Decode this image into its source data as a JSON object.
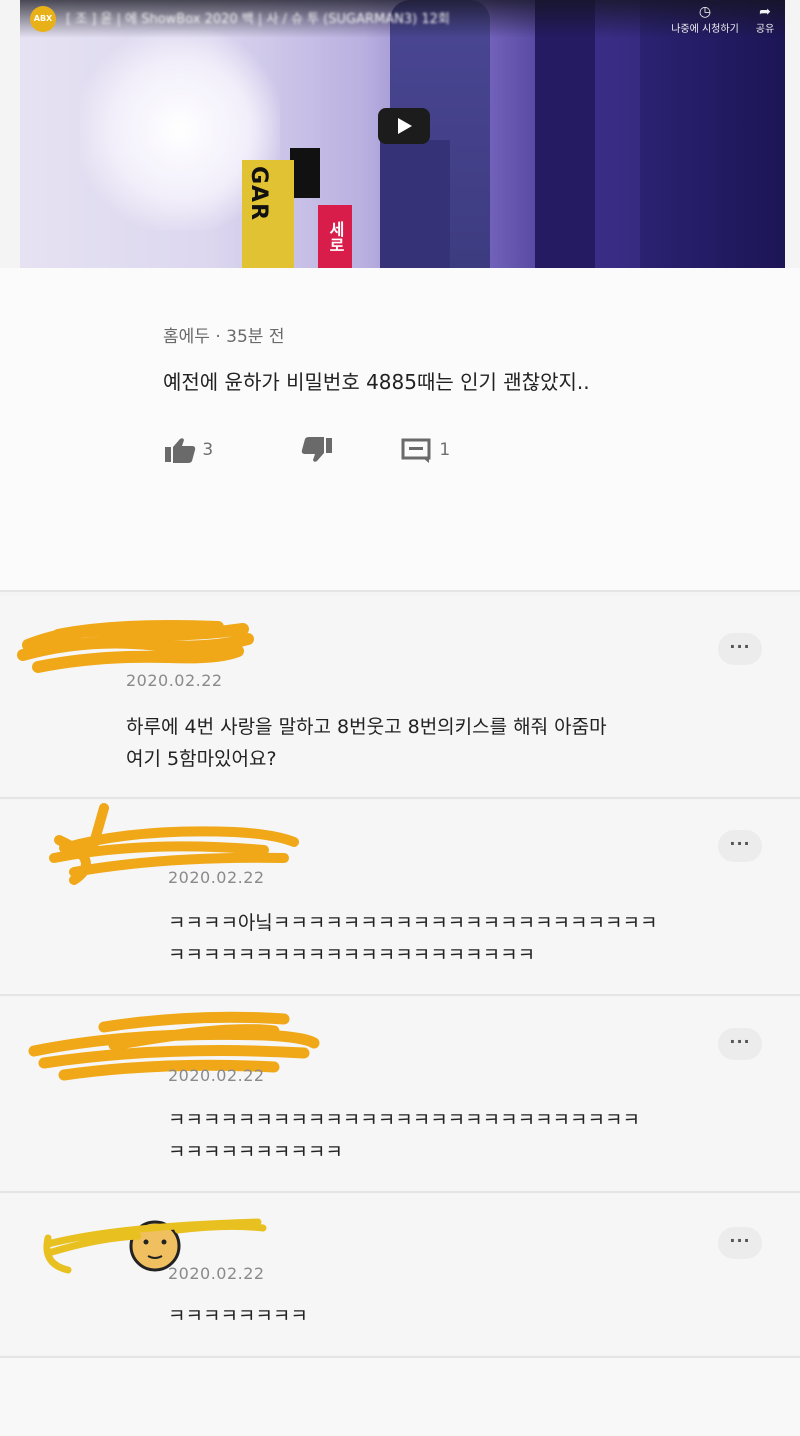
{
  "video": {
    "channel_badge": "ABX",
    "title": "[ 조 ] 윤 | 에 ShowBox 2020 백 | 사 / 슈 투 (SUGARMAN3) 12회",
    "watch_later_label": "나중에 시청하기",
    "share_label": "공유",
    "logo_text_1": "GAR",
    "logo_text_2": "세로"
  },
  "top_comment": {
    "author": "홈에두",
    "time": "35분 전",
    "text": "예전에 윤하가 비밀번호 4885때는 인기 괜찮았지..",
    "likes": "3",
    "replies": "1"
  },
  "comments": [
    {
      "date": "2020.02.22",
      "line1": "하루에 4번 사랑을 말하고 8번웃고 8번의키스를 해줘 아줌마",
      "line2": "여기 5함마있어요?",
      "more": "···"
    },
    {
      "date": "2020.02.22",
      "line1": "ㅋㅋㅋㅋ아닠ㅋㅋㅋㅋㅋㅋㅋㅋㅋㅋㅋㅋㅋㅋㅋㅋㅋㅋㅋㅋㅋㅋ",
      "line2": "ㅋㅋㅋㅋㅋㅋㅋㅋㅋㅋㅋㅋㅋㅋㅋㅋㅋㅋㅋㅋㅋ",
      "more": "···"
    },
    {
      "date": "2020.02.22",
      "line1": "ㅋㅋㅋㅋㅋㅋㅋㅋㅋㅋㅋㅋㅋㅋㅋㅋㅋㅋㅋㅋㅋㅋㅋㅋㅋㅋㅋ",
      "line2": "ㅋㅋㅋㅋㅋㅋㅋㅋㅋㅋ",
      "more": "···"
    },
    {
      "date": "2020.02.22",
      "line1": "ㅋㅋㅋㅋㅋㅋㅋㅋ",
      "line2": "",
      "more": "···"
    }
  ],
  "colors": {
    "redaction": "#f0a818",
    "background": "#f6f6f6",
    "text": "#222222",
    "meta": "#8a8a8a"
  }
}
